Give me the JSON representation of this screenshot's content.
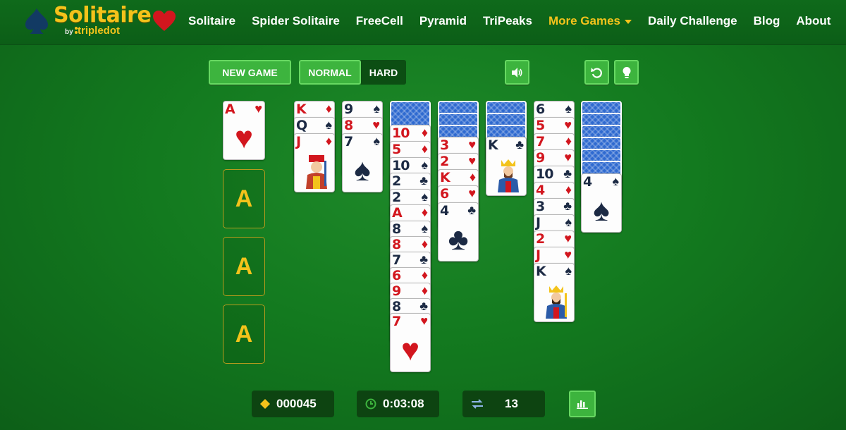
{
  "brand": {
    "title": "Solitaire",
    "by": "by",
    "company": "tripledot"
  },
  "nav": {
    "items": [
      "Solitaire",
      "Spider Solitaire",
      "FreeCell",
      "Pyramid",
      "TriPeaks",
      "More Games",
      "Daily Challenge",
      "Blog",
      "About"
    ],
    "active": "More Games"
  },
  "toolbar": {
    "new_game": "NEW GAME",
    "normal": "NORMAL",
    "hard": "HARD",
    "difficulty_selected": "NORMAL"
  },
  "foundations": [
    {
      "label": "A",
      "top_card": "A♥"
    },
    {
      "label": "A"
    },
    {
      "label": "A"
    },
    {
      "label": "A"
    }
  ],
  "tableau": [
    {
      "face_down": 0,
      "face_up": [
        "K♦",
        "Q♠",
        "J♦"
      ]
    },
    {
      "face_down": 0,
      "face_up": [
        "9♠",
        "8♥",
        "7♠"
      ]
    },
    {
      "face_down": 1,
      "face_up": [
        "10♦",
        "5♦",
        "10♠",
        "2♣",
        "2♠",
        "A♦",
        "8♠",
        "8♦",
        "7♣",
        "6♦",
        "9♦",
        "8♣",
        "7♥"
      ]
    },
    {
      "face_down": 3,
      "face_up": [
        "3♥",
        "2♥",
        "K♦",
        "6♥",
        "4♣"
      ]
    },
    {
      "face_down": 3,
      "face_up": [
        "K♣"
      ]
    },
    {
      "face_down": 0,
      "face_up": [
        "6♠",
        "5♥",
        "7♦",
        "9♥",
        "10♣",
        "4♦",
        "3♣",
        "J♠",
        "2♥",
        "J♥",
        "K♠"
      ]
    },
    {
      "face_down": 6,
      "face_up": [
        "4♠"
      ]
    }
  ],
  "stats": {
    "score": "000045",
    "time": "0:03:08",
    "moves": "13"
  },
  "colors": {
    "felt": "#137a1f",
    "gold": "#f3c31b",
    "button": "#3db43e",
    "stat_bg": "#0d4411",
    "red_suit": "#d2161e",
    "black_suit": "#1c2a44",
    "card_back": "#2f6ad0"
  },
  "icons": {
    "sound": "speaker-icon",
    "undo": "undo-icon",
    "hint": "lightbulb-icon",
    "score": "diamond-icon",
    "time": "clock-icon",
    "moves": "swap-icon",
    "stats": "bar-chart-icon"
  }
}
